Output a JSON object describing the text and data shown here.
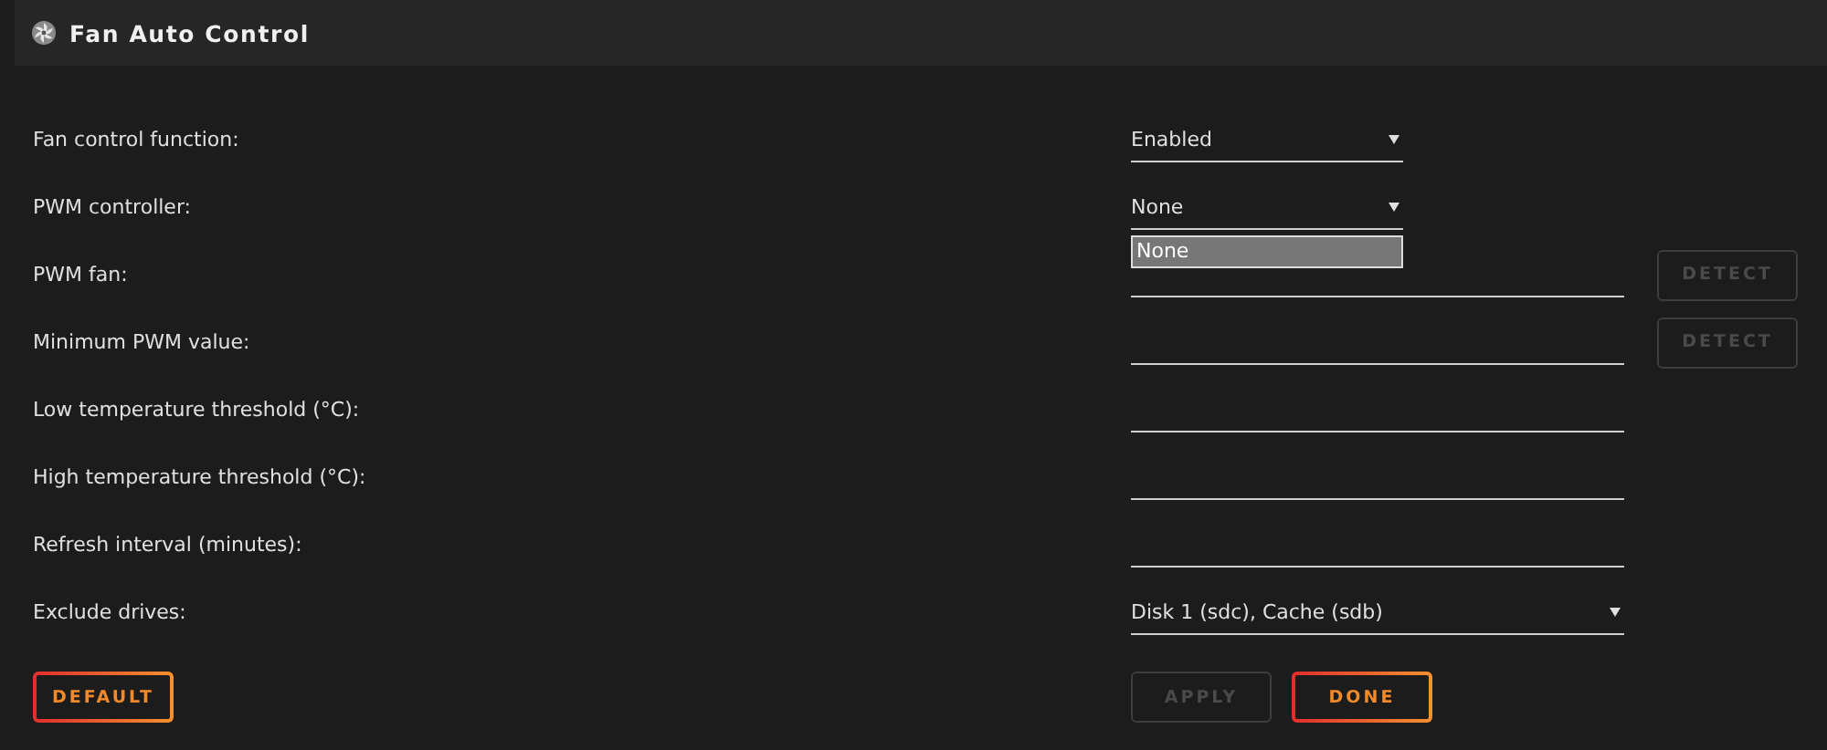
{
  "header": {
    "title": "Fan Auto Control"
  },
  "rows": [
    {
      "label": "Fan control function:",
      "kind": "select",
      "value": "Enabled"
    },
    {
      "label": "PWM controller:",
      "kind": "select",
      "value": "None",
      "expanded": true,
      "options": [
        {
          "label": "None",
          "selected": true
        }
      ]
    },
    {
      "label": "PWM fan:",
      "kind": "text",
      "action": {
        "label": "DETECT",
        "disabled": true
      }
    },
    {
      "label": "Minimum PWM value:",
      "kind": "text",
      "action": {
        "label": "DETECT",
        "disabled": true
      }
    },
    {
      "label": "Low temperature threshold (°C):",
      "kind": "text"
    },
    {
      "label": "High temperature threshold (°C):",
      "kind": "text"
    },
    {
      "label": "Refresh interval (minutes):",
      "kind": "text"
    },
    {
      "label": "Exclude drives:",
      "kind": "multiselect",
      "value": "Disk 1 (sdc), Cache (sdb)"
    }
  ],
  "buttons": [
    {
      "label": "DEFAULT",
      "disabled": false
    },
    {
      "label": "APPLY",
      "disabled": true
    },
    {
      "label": "DONE",
      "disabled": false
    }
  ]
}
